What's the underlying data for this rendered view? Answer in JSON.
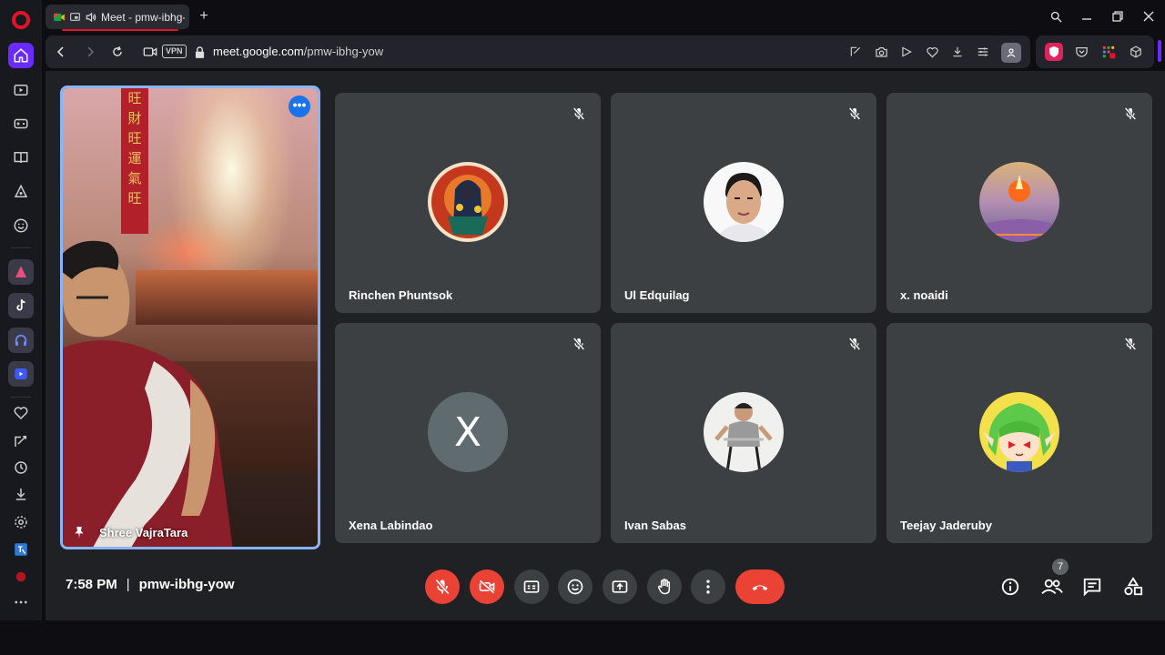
{
  "browser": {
    "tab": {
      "title": "Meet - pmw-ibhg-yow"
    },
    "new_tab_label": "+",
    "address": {
      "vpn_badge": "VPN",
      "url_host": "meet.google.com",
      "url_path": "/pmw-ibhg-yow"
    }
  },
  "featured": {
    "name": "Shree VajraTara",
    "more_label": "•••",
    "banner_chars": [
      "旺",
      "財",
      "旺",
      "運",
      "氣",
      "旺"
    ]
  },
  "participants": [
    {
      "name": "Rinchen Phuntsok",
      "avatar": "thangka-deity"
    },
    {
      "name": "Ul Edquilag",
      "avatar": "man-portrait"
    },
    {
      "name": "x. noaidi",
      "avatar": "sunset-fire"
    },
    {
      "name": "Xena Labindao",
      "avatar": "letter",
      "letter": "X"
    },
    {
      "name": "Ivan Sabas",
      "avatar": "man-grey-shirt"
    },
    {
      "name": "Teejay Jaderuby",
      "avatar": "anime-green-hair"
    }
  ],
  "meeting": {
    "time": "7:58 PM",
    "separator": "|",
    "code": "pmw-ibhg-yow",
    "participant_count": "7"
  },
  "colors": {
    "meet_bg": "#202124",
    "tile_bg": "#3c4043",
    "danger": "#ea4335",
    "highlight": "#8ab4f8",
    "opera_red": "#e0132b",
    "opera_purple": "#6a2bff"
  }
}
